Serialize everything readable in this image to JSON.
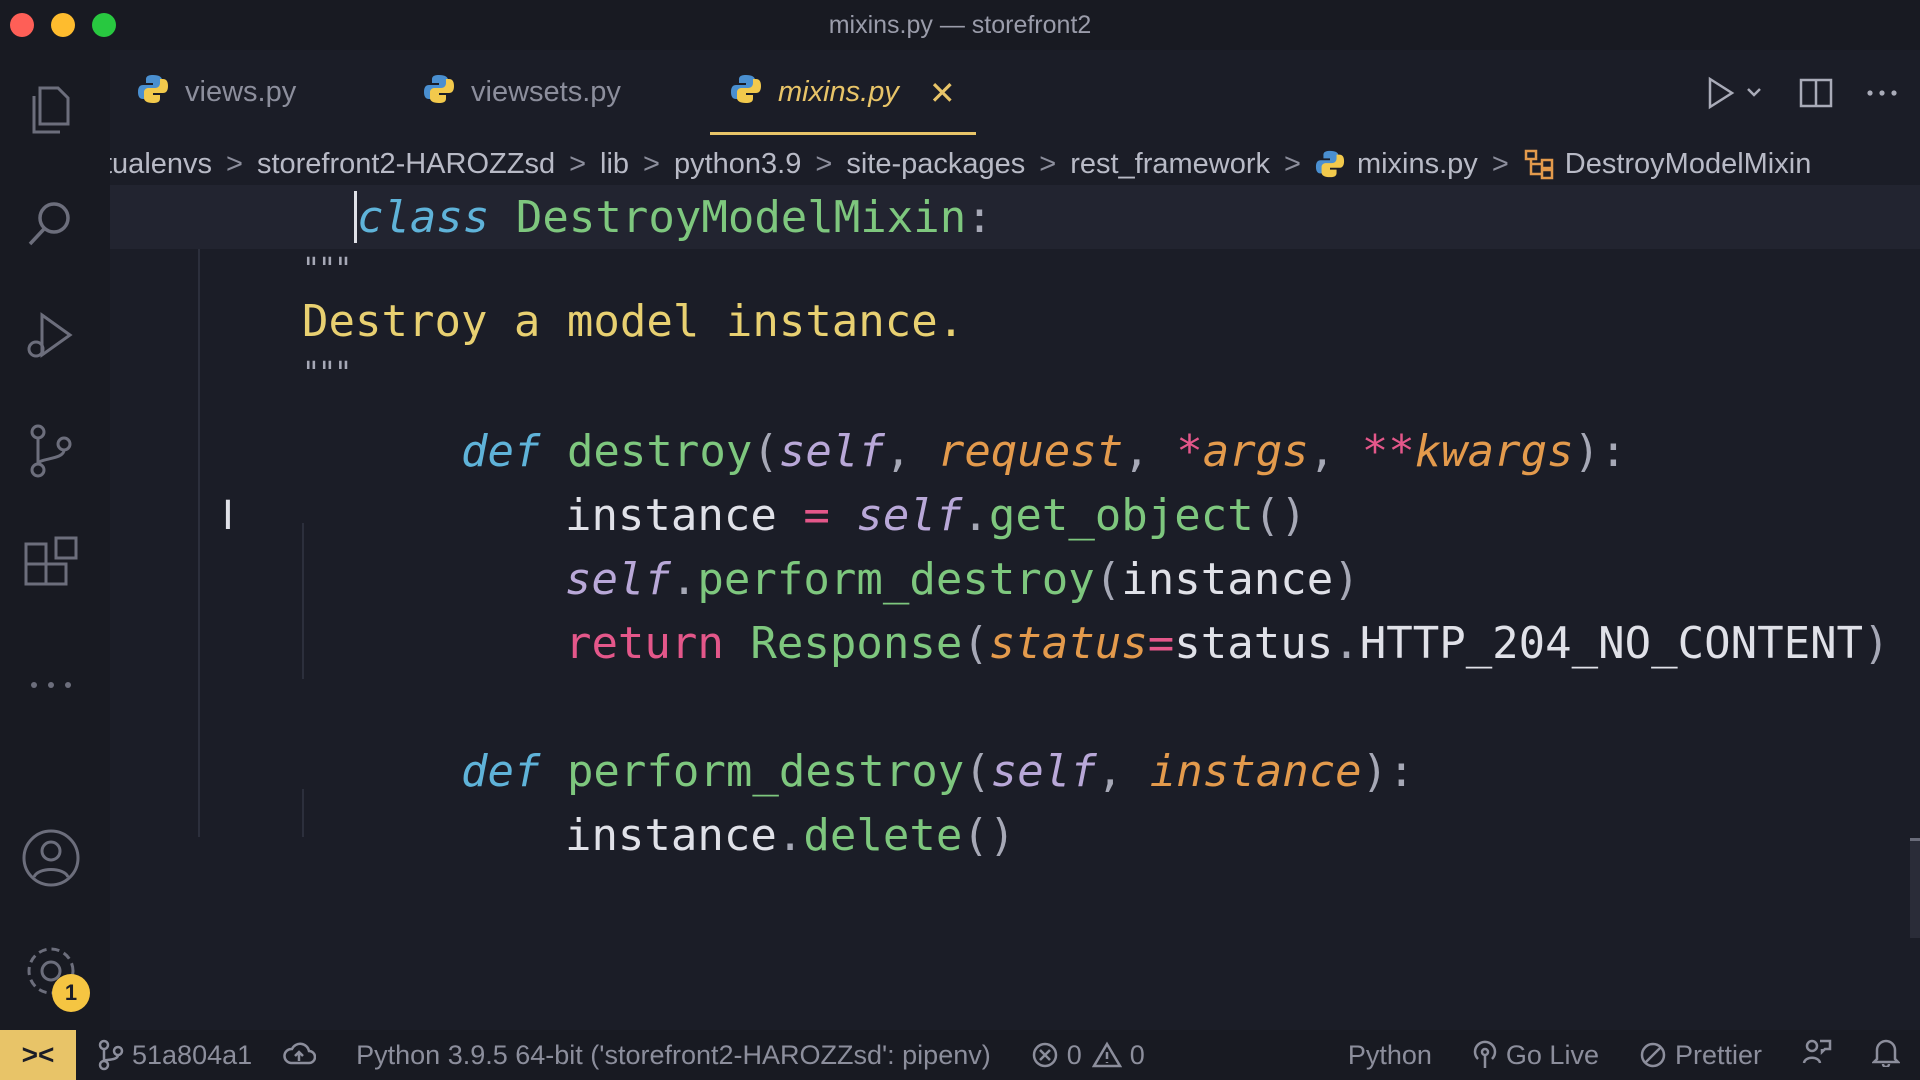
{
  "window": {
    "title": "mixins.py — storefront2"
  },
  "tabs": [
    {
      "label": "views.py"
    },
    {
      "label": "viewsets.py"
    },
    {
      "label": "mixins.py",
      "close": "✕"
    }
  ],
  "breadcrumb": [
    "tualenvs",
    "storefront2-HAROZZsd",
    "lib",
    "python3.9",
    "site-packages",
    "rest_framework",
    "mixins.py",
    "DestroyModelMixin"
  ],
  "code": {
    "l1": {
      "kw": "class",
      "cls": "DestroyModelMixin",
      "colon": ":"
    },
    "l2": {
      "q": "\"\"\""
    },
    "l3": {
      "text": "Destroy a model instance."
    },
    "l4": {
      "q": "\"\"\""
    },
    "l5": {
      "kw": "def",
      "fn": "destroy",
      "p1": "(",
      "self": "self",
      "c1": ", ",
      "req": "request",
      "c2": ", ",
      "star1": "*",
      "args": "args",
      "c3": ", ",
      "star2": "**",
      "kwargs": "kwargs",
      "end": "):"
    },
    "l6": {
      "a": "instance ",
      "eq": "=",
      "sp": " ",
      "self": "self",
      "dot": ".",
      "fn": "get_object",
      "par": "()"
    },
    "l7": {
      "self": "self",
      "dot": ".",
      "fn": "perform_destroy",
      "p1": "(",
      "arg": "instance",
      "p2": ")"
    },
    "l8": {
      "ret": "return",
      "sp": " ",
      "fn": "Response",
      "p1": "(",
      "kw": "status",
      "eq": "=",
      "val": "status",
      "dot": ".",
      "const": "HTTP_204_NO_CONTENT",
      "p2": ")"
    },
    "l9": {
      "kw": "def",
      "fn": "perform_destroy",
      "p1": "(",
      "self": "self",
      "c1": ", ",
      "inst": "instance",
      "end": "):"
    },
    "l10": {
      "a": "instance",
      "dot": ".",
      "fn": "delete",
      "par": "()"
    }
  },
  "status": {
    "remote": "><",
    "branch": "51a804a1",
    "interpreter": "Python 3.9.5 64-bit ('storefront2-HAROZZsd': pipenv)",
    "errors": "0",
    "warnings": "0",
    "language": "Python",
    "golive": "Go Live",
    "prettier": "Prettier"
  },
  "settings_badge": "1",
  "colors": {
    "accent": "#e8c468",
    "background": "#1b1d27",
    "keyword": "#5fb3d9",
    "function": "#7ec77e",
    "docstring": "#e8d071"
  }
}
